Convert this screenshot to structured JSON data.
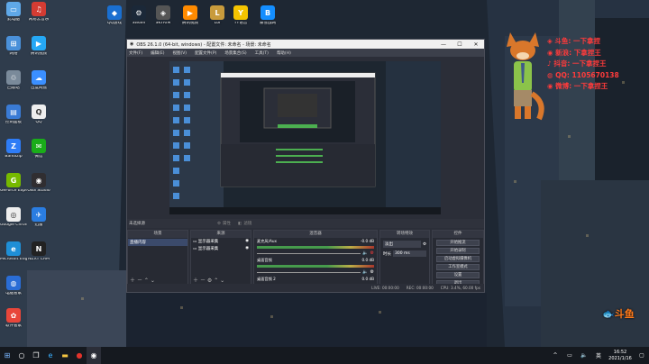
{
  "desktop_icons": [
    {
      "label": "此电脑",
      "icon": "pc-icon",
      "color": "#5fa8e8",
      "glyph": "▭"
    },
    {
      "label": "网易云音乐",
      "icon": "netease-music-icon",
      "color": "#d43c33",
      "glyph": "♫"
    },
    {
      "label": "QQ游戏",
      "icon": "qq-games-icon",
      "color": "#1a6fd0",
      "glyph": "◆"
    },
    {
      "label": "Steam",
      "icon": "steam-icon",
      "color": "#1b2838",
      "glyph": "⚙"
    },
    {
      "label": "SKYRIM",
      "icon": "skyrim-icon",
      "color": "#555",
      "glyph": "◈"
    },
    {
      "label": "腾讯视频",
      "icon": "tencent-video-icon",
      "color": "#ff8a00",
      "glyph": "▶"
    },
    {
      "label": "Lol",
      "icon": "lol-icon",
      "color": "#c89b3c",
      "glyph": "L"
    },
    {
      "label": "YY语音",
      "icon": "yy-icon",
      "color": "#f5c400",
      "glyph": "Y"
    },
    {
      "label": "暴雪战网",
      "icon": "battlenet-icon",
      "color": "#148eff",
      "glyph": "B"
    },
    {
      "label": "网络",
      "icon": "network-icon",
      "color": "#4a90d9",
      "glyph": "⊞"
    },
    {
      "label": "腾讯视频",
      "icon": "tencent-video-icon-2",
      "color": "#25a8f5",
      "glyph": "▶"
    },
    {
      "label": "回收站",
      "icon": "recycle-bin-icon",
      "color": "#7a8a9a",
      "glyph": "♲"
    },
    {
      "label": "百度网盘",
      "icon": "baidu-pan-icon",
      "color": "#3b8fff",
      "glyph": "☁"
    },
    {
      "label": "控制面板",
      "icon": "control-panel-icon",
      "color": "#3a7bd5",
      "glyph": "▤"
    },
    {
      "label": "QQ",
      "icon": "qq-icon",
      "color": "#eee",
      "glyph": "Q"
    },
    {
      "label": "Bandizip",
      "icon": "bandizip-icon",
      "color": "#2e7cf6",
      "glyph": "Z"
    },
    {
      "label": "微信",
      "icon": "wechat-icon",
      "color": "#1aad19",
      "glyph": "✉"
    },
    {
      "label": "GeForce Experience",
      "icon": "geforce-icon",
      "color": "#76b900",
      "glyph": "G"
    },
    {
      "label": "OBS Studio",
      "icon": "obs-icon",
      "color": "#302e31",
      "glyph": "◉"
    },
    {
      "label": "Google Chrome",
      "icon": "chrome-icon",
      "color": "#eee",
      "glyph": "◎"
    },
    {
      "label": "迅雷",
      "icon": "xunlei-icon",
      "color": "#2a7de1",
      "glyph": "✈"
    },
    {
      "label": "Microsoft Edge",
      "icon": "edge-icon",
      "color": "#1f8fd6",
      "glyph": "e"
    },
    {
      "label": "NZXT CAM",
      "icon": "nzxt-icon",
      "color": "#222",
      "glyph": "N"
    },
    {
      "label": "电脑管家",
      "icon": "pc-manager-icon",
      "color": "#2a6dd6",
      "glyph": "◍"
    },
    {
      "label": "软件管家",
      "icon": "software-manager-icon",
      "color": "#e8463a",
      "glyph": "✿"
    }
  ],
  "obs": {
    "title": "OBS 26.1.0 (64-bit, windows) - 配置文件: 未命名 - 场景: 未命名",
    "window_buttons": [
      "—",
      "☐",
      "✕"
    ],
    "menu": [
      "文件(F)",
      "编辑(E)",
      "视图(V)",
      "配置文件(P)",
      "场景集合(S)",
      "工具(T)",
      "帮助(H)"
    ],
    "source_bar": {
      "no_source": "未选择源",
      "properties": "属性",
      "filters": "滤镜"
    },
    "docks": {
      "scenes": {
        "title": "场景",
        "items": [
          "直播内容"
        ]
      },
      "sources": {
        "title": "来源",
        "items": [
          "显示器采集",
          "显示器采集"
        ]
      },
      "mixer": {
        "title": "混音器",
        "tracks": [
          {
            "name": "麦克风/Aux",
            "db": "-0.0 dB"
          },
          {
            "name": "桌面音频",
            "db": "0.0 dB"
          },
          {
            "name": "桌面音频 2",
            "db": "0.0 dB"
          }
        ]
      },
      "transitions": {
        "title": "转场特效",
        "type": "淡出",
        "duration_label": "时长",
        "duration": "300 ms"
      },
      "controls": {
        "title": "控件",
        "buttons": [
          "开始推流",
          "开始录制",
          "启动虚拟摄像机",
          "工作室模式",
          "设置",
          "退出"
        ]
      }
    },
    "status": {
      "live": "LIVE: 00:00:00",
      "rec": "REC: 00:00:00",
      "cpu": "CPU: 3.4%, 60.00 fps"
    }
  },
  "overlay": {
    "lines": [
      "斗鱼: 一下拿捏",
      "新浪: 下拿捏王",
      "抖音: 一下拿捏王",
      "QQ: 1105670138",
      "微博: 一下拿捏王"
    ],
    "douyu_logo": "斗鱼"
  },
  "taskbar": {
    "icons": [
      "windows-start-icon",
      "search-icon",
      "task-view-icon",
      "edge-icon",
      "explorer-icon",
      "netease-music-icon",
      "obs-icon"
    ],
    "tray": {
      "lang": "英",
      "time": "16:52",
      "date": "2021/1/16"
    }
  }
}
